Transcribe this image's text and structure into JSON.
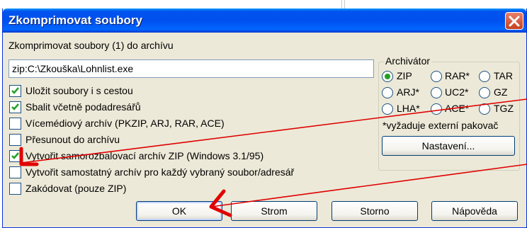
{
  "window": {
    "title": "Zkomprimovat soubory",
    "close_icon": "close-x-icon"
  },
  "header": {
    "label": "Zkomprimovat soubory (1) do archívu"
  },
  "archive_path": {
    "value": "zip:C:\\Zkouška\\Lohnlist.exe"
  },
  "options": [
    {
      "label": "Uložit soubory i s cestou",
      "checked": true
    },
    {
      "label": "Sbalit včetně podadresářů",
      "checked": true
    },
    {
      "label": "Vícemédiový archív (PKZIP, ARJ, RAR, ACE)",
      "checked": false
    },
    {
      "label": "Přesunout do archívu",
      "checked": false
    },
    {
      "label": "Vytvořit samorozbalovací archív ZIP (Windows 3.1/95)",
      "checked": true
    },
    {
      "label": "Vytvořit samostatný archív pro každý vybraný soubor/adresář",
      "checked": false
    },
    {
      "label": "Zakódovat (pouze ZIP)",
      "checked": false
    }
  ],
  "archiver": {
    "legend": "Archivátor",
    "radios": [
      {
        "label": "ZIP",
        "selected": true
      },
      {
        "label": "RAR*",
        "selected": false
      },
      {
        "label": "TAR",
        "selected": false
      },
      {
        "label": "ARJ*",
        "selected": false
      },
      {
        "label": "UC2*",
        "selected": false
      },
      {
        "label": "GZ",
        "selected": false
      },
      {
        "label": "LHA*",
        "selected": false
      },
      {
        "label": "ACE*",
        "selected": false
      },
      {
        "label": "TGZ",
        "selected": false
      }
    ],
    "note": "*vyžaduje externí pakovač",
    "settings_button": "Nastavení..."
  },
  "buttons": {
    "ok": "OK",
    "tree": "Strom",
    "cancel": "Storno",
    "help": "Nápověda"
  },
  "colors": {
    "titlebar": "#0053ee",
    "annotation": "#e00000",
    "check": "#21a121"
  }
}
